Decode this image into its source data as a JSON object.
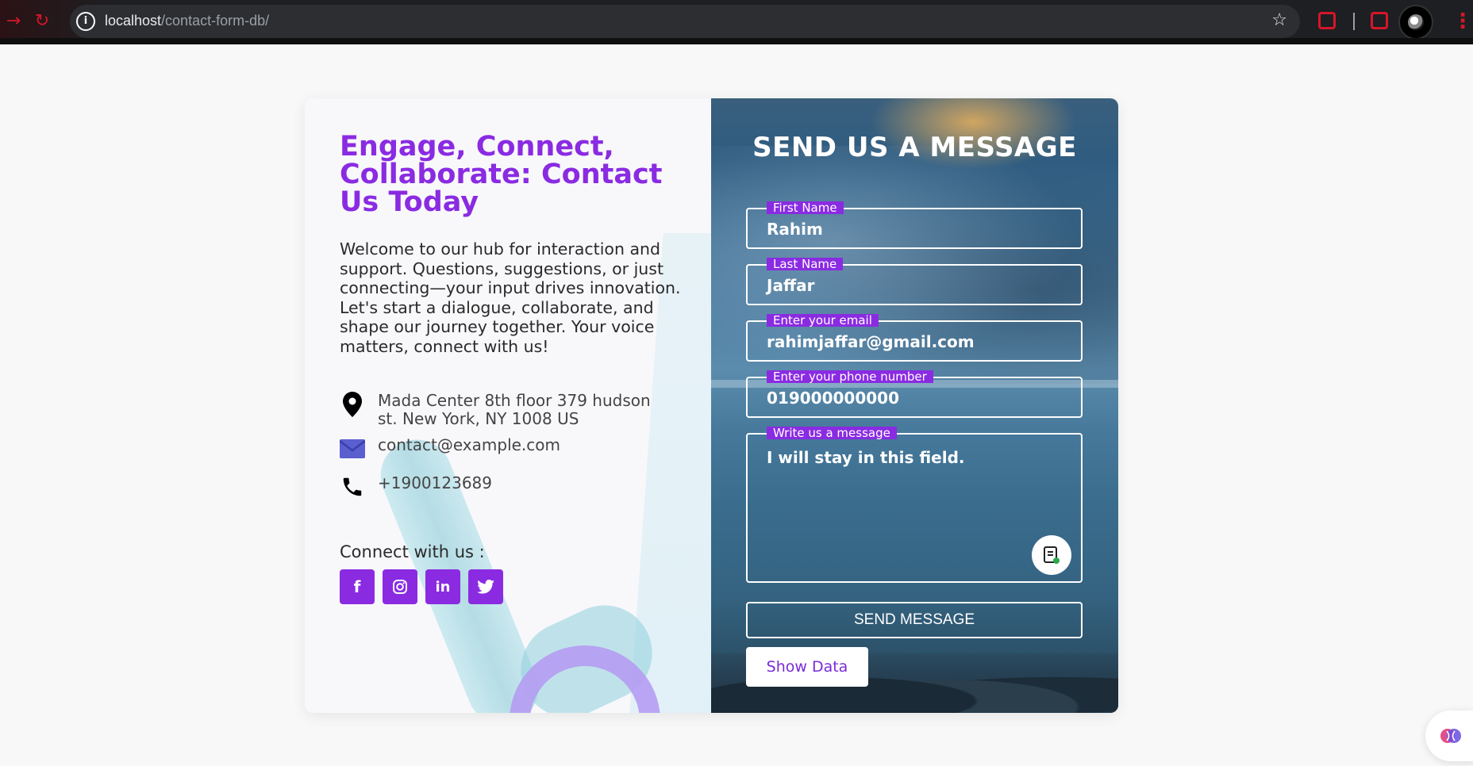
{
  "browser": {
    "url_host": "localhost",
    "url_path": "/contact-form-db/"
  },
  "left": {
    "title": "Engage, Connect, Collaborate: Contact Us Today",
    "intro": "Welcome to our hub for interaction and support. Questions, suggestions, or just connecting—your input drives innovation. Let's start a dialogue, collaborate, and shape our journey together. Your voice matters, connect with us!",
    "address": "Mada Center 8th floor 379 hudson st. New York, NY 1008 US",
    "email": "contact@example.com",
    "phone": "+1900123689",
    "connect_label": "Connect with us :",
    "socials": [
      "facebook",
      "instagram",
      "linkedin",
      "twitter"
    ]
  },
  "form": {
    "title": "SEND US A MESSAGE",
    "first_name": {
      "label": "First Name",
      "value": "Rahim"
    },
    "last_name": {
      "label": "Last Name",
      "value": "Jaffar"
    },
    "email": {
      "label": "Enter your email",
      "value": "rahimjaffar@gmail.com"
    },
    "phone": {
      "label": "Enter your phone number",
      "value": "019000000000"
    },
    "message": {
      "label": "Write us a message",
      "value": "I will stay in this field."
    },
    "send_label": "SEND MESSAGE",
    "show_label": "Show Data"
  },
  "colors": {
    "accent": "#8a2be2",
    "chrome_red": "#d6162a"
  }
}
